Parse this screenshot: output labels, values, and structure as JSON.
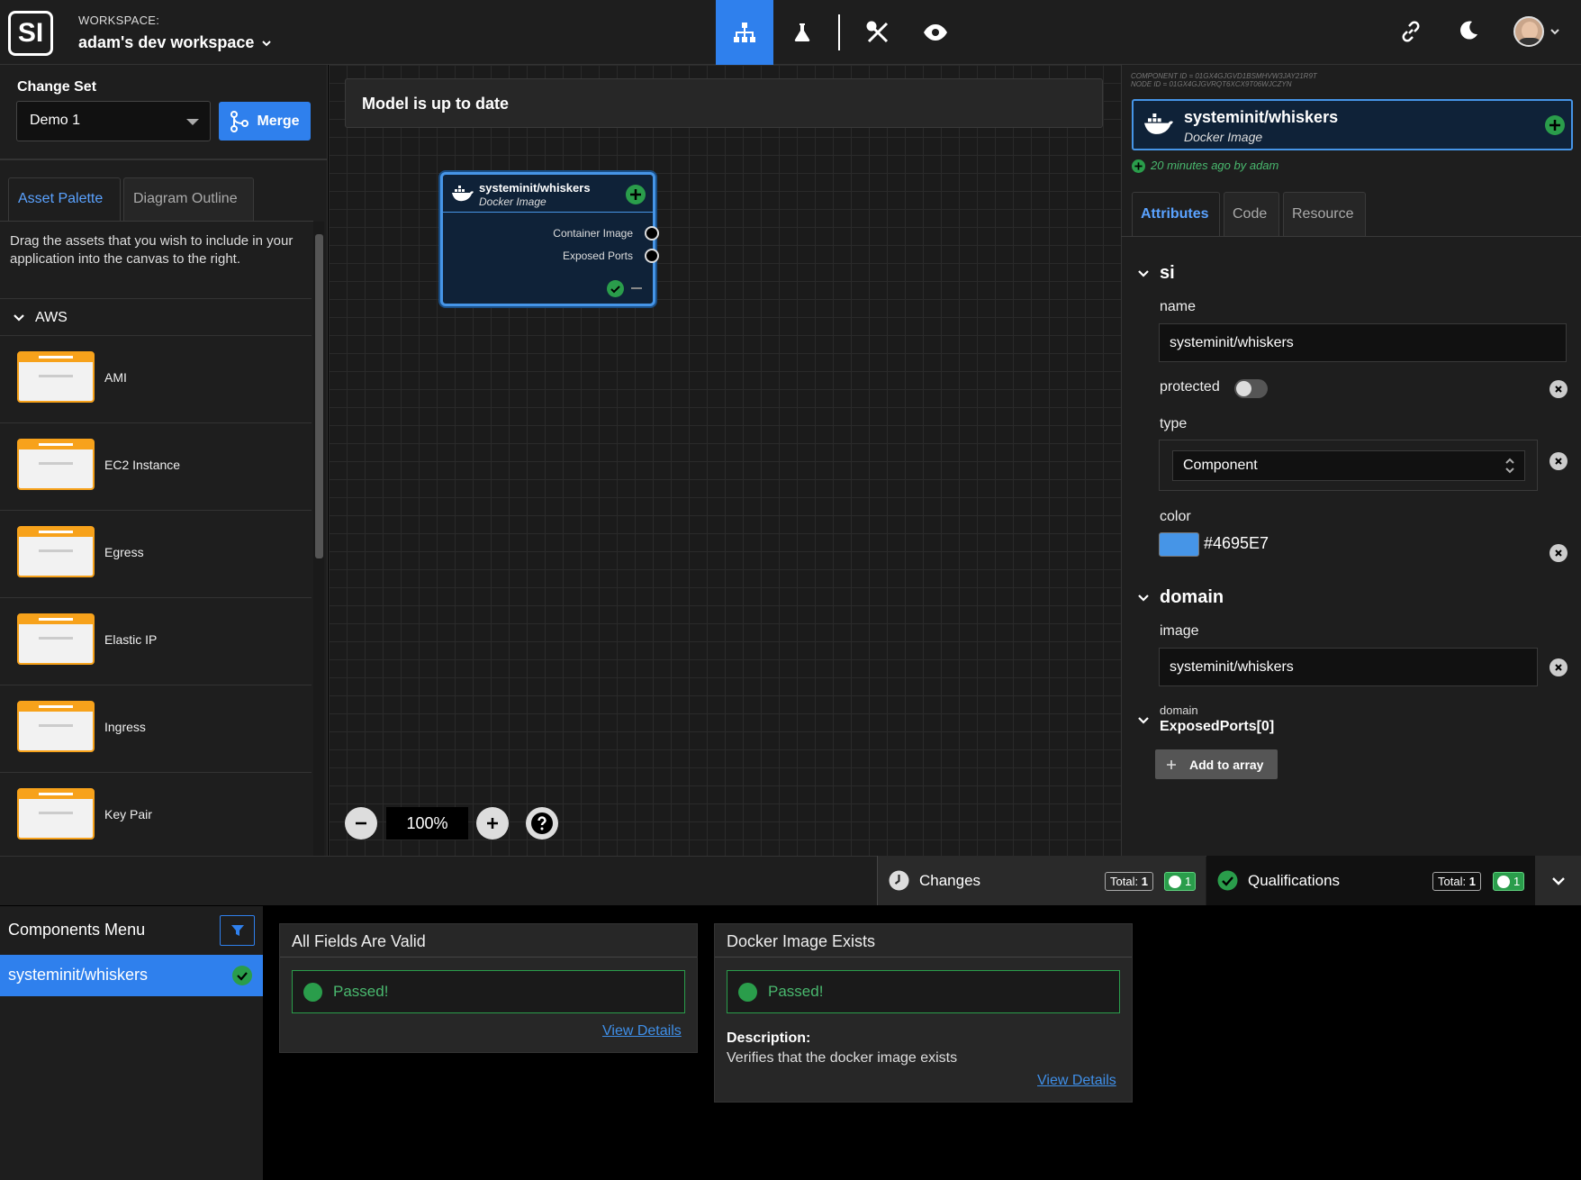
{
  "topbar": {
    "logo": "SI",
    "workspace_label": "WORKSPACE:",
    "workspace_name": "adam's dev workspace"
  },
  "change_set": {
    "label": "Change Set",
    "selected": "Demo 1",
    "merge_label": "Merge"
  },
  "left_tabs": [
    "Asset Palette",
    "Diagram Outline"
  ],
  "asset_palette": {
    "description": "Drag the assets that you wish to include in your application into the canvas to the right.",
    "group": "AWS",
    "items": [
      "AMI",
      "EC2 Instance",
      "Egress",
      "Elastic IP",
      "Ingress",
      "Key Pair"
    ]
  },
  "canvas": {
    "status": "Model is up to date",
    "zoom": "100%",
    "node": {
      "title": "systeminit/whiskers",
      "subtitle": "Docker Image",
      "sockets": [
        "Container Image",
        "Exposed Ports"
      ]
    }
  },
  "component": {
    "component_id": "COMPONENT ID = 01GX4GJGVD1BSMHVW3JAY21R9T",
    "node_id": "NODE ID = 01GX4GJGVRQT6XCX9T06WJCZYN",
    "title": "systeminit/whiskers",
    "subtitle": "Docker Image",
    "updated": "20 minutes ago by adam"
  },
  "right_tabs": [
    "Attributes",
    "Code",
    "Resource"
  ],
  "attributes": {
    "si_section": "si",
    "name_label": "name",
    "name_value": "systeminit/whiskers",
    "protected_label": "protected",
    "type_label": "type",
    "type_value": "Component",
    "color_label": "color",
    "color_value": "#4695E7",
    "domain_section": "domain",
    "image_label": "image",
    "image_value": "systeminit/whiskers",
    "array_parent": "domain",
    "array_name": "ExposedPorts[0]",
    "add_array_label": "Add to array"
  },
  "bottom": {
    "changes_label": "Changes",
    "changes_total_label": "Total:",
    "changes_total": "1",
    "changes_added": "1",
    "qualifications_label": "Qualifications",
    "qual_total_label": "Total:",
    "qual_total": "1",
    "qual_passed": "1"
  },
  "components_menu": {
    "title": "Components Menu",
    "items": [
      "systeminit/whiskers"
    ]
  },
  "qualifications": [
    {
      "title": "All Fields Are Valid",
      "status": "Passed!",
      "link": "View Details"
    },
    {
      "title": "Docker Image Exists",
      "status": "Passed!",
      "description_label": "Description:",
      "description": "Verifies that the docker image exists",
      "link": "View Details"
    }
  ],
  "colors": {
    "accent": "#2f80ed",
    "node_color": "#4695E7",
    "success": "#2a9d4b",
    "asset_orange": "#f7a21b"
  }
}
